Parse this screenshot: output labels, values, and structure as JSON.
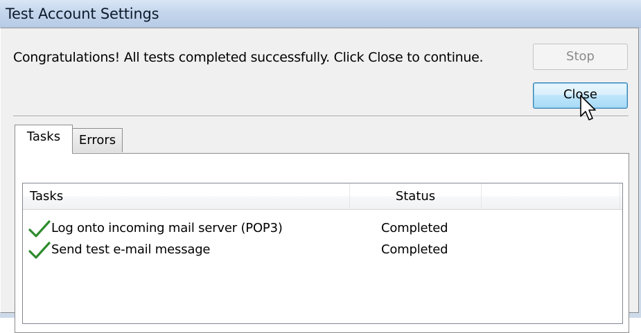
{
  "window": {
    "title": "Test Account Settings"
  },
  "message": "Congratulations! All tests completed successfully. Click Close to continue.",
  "buttons": {
    "stop_label": "Stop",
    "close_label": "Close"
  },
  "tabs": [
    {
      "label": "Tasks",
      "selected": true
    },
    {
      "label": "Errors",
      "selected": false
    }
  ],
  "list": {
    "columns": [
      "Tasks",
      "Status"
    ],
    "rows": [
      {
        "task": "Log onto incoming mail server (POP3)",
        "status": "Completed",
        "icon": "green-check-icon"
      },
      {
        "task": "Send test e-mail message",
        "status": "Completed",
        "icon": "green-check-icon"
      }
    ]
  },
  "colors": {
    "check_green": "#2e8b2e",
    "close_button_border": "#3c7fb1",
    "title_bar": "#c4d6ec"
  }
}
